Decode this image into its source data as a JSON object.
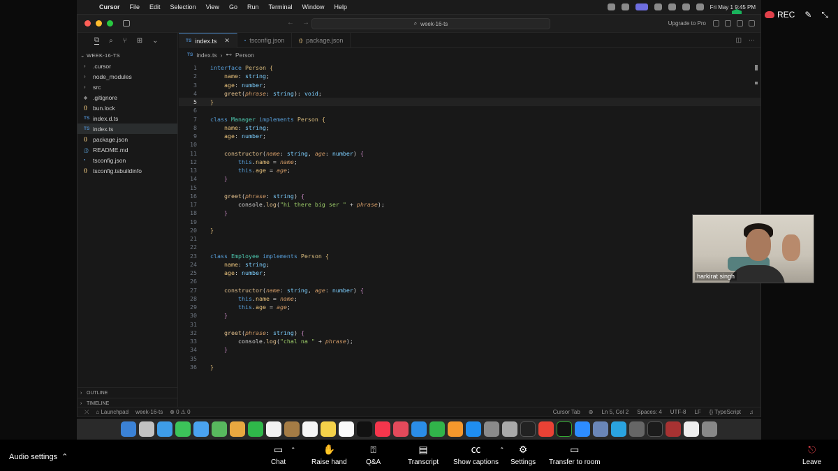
{
  "menubar": {
    "app": "Cursor",
    "items": [
      "File",
      "Edit",
      "Selection",
      "View",
      "Go",
      "Run",
      "Terminal",
      "Window",
      "Help"
    ],
    "clock": "Fri May 1  9:45 PM"
  },
  "zoom_top": {
    "rec": "REC"
  },
  "window": {
    "search": "week-16-ts",
    "upgrade": "Upgrade to Pro"
  },
  "explorer": {
    "root": "WEEK-16-TS",
    "items": [
      {
        "label": ".cursor",
        "type": "folder"
      },
      {
        "label": "node_modules",
        "type": "folder"
      },
      {
        "label": "src",
        "type": "folder"
      },
      {
        "label": ".gitignore",
        "type": "git"
      },
      {
        "label": "bun.lock",
        "type": "lock"
      },
      {
        "label": "index.d.ts",
        "type": "ts"
      },
      {
        "label": "index.ts",
        "type": "ts"
      },
      {
        "label": "package.json",
        "type": "json"
      },
      {
        "label": "README.md",
        "type": "md"
      },
      {
        "label": "tsconfig.json",
        "type": "tsc"
      },
      {
        "label": "tsconfig.tsbuildinfo",
        "type": "json"
      }
    ],
    "outline": "OUTLINE",
    "timeline": "TIMELINE"
  },
  "tabs": [
    {
      "label": "index.ts",
      "icon": "TS"
    },
    {
      "label": "tsconfig.json",
      "icon": "TS"
    },
    {
      "label": "package.json",
      "icon": "{}"
    }
  ],
  "breadcrumb": {
    "file": "index.ts",
    "symbol": "Person"
  },
  "status": {
    "launchpad": "Launchpad",
    "folder": "week-16-ts",
    "problems": "⊗ 0 ⚠ 0",
    "cursor_tab": "Cursor Tab",
    "position": "Ln 5, Col 2",
    "spaces": "Spaces: 4",
    "encoding": "UTF-8",
    "eol": "LF",
    "language": "TypeScript"
  },
  "webcam": {
    "name": "harkirat singh"
  },
  "zoom_bar": {
    "audio": "Audio settings",
    "chat": "Chat",
    "raise_hand": "Raise hand",
    "qa": "Q&A",
    "transcript": "Transcript",
    "captions": "Show captions",
    "settings": "Settings",
    "transfer": "Transfer to room",
    "leave": "Leave"
  }
}
